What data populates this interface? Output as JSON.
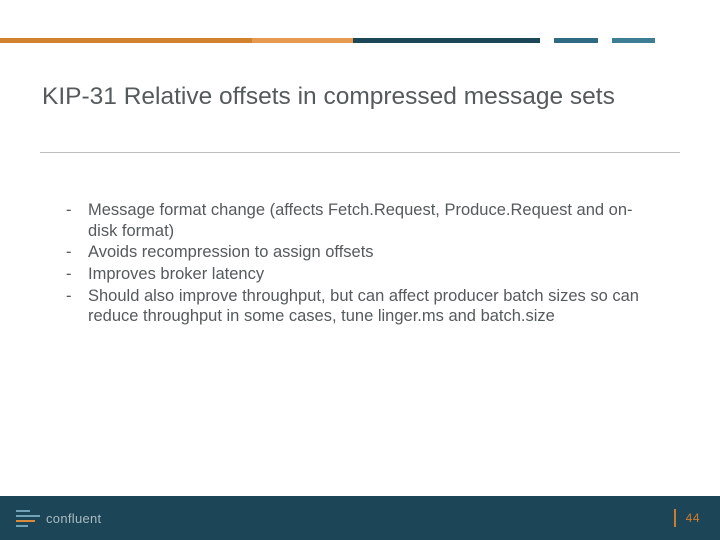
{
  "accent": {
    "segments": [
      {
        "color": "#d2812f",
        "flex": 35
      },
      {
        "color": "#e69a4f",
        "flex": 14
      },
      {
        "color": "#1c4758",
        "flex": 26
      },
      {
        "color": "#ffffff",
        "flex": 2
      },
      {
        "color": "#2f6a82",
        "flex": 6
      },
      {
        "color": "#ffffff",
        "flex": 2
      },
      {
        "color": "#3d7e95",
        "flex": 6
      },
      {
        "color": "#ffffff",
        "flex": 9
      }
    ]
  },
  "title": "KIP-31 Relative offsets in compressed message sets",
  "bullets": [
    "Message format change (affects Fetch.Request, Produce.Request and on-disk format)",
    "Avoids recompression to assign offsets",
    "Improves broker latency",
    "Should also improve throughput, but can affect producer batch sizes so can reduce throughput in some cases, tune linger.ms and batch.size"
  ],
  "footer": {
    "page": "44",
    "brand": "confluent"
  }
}
